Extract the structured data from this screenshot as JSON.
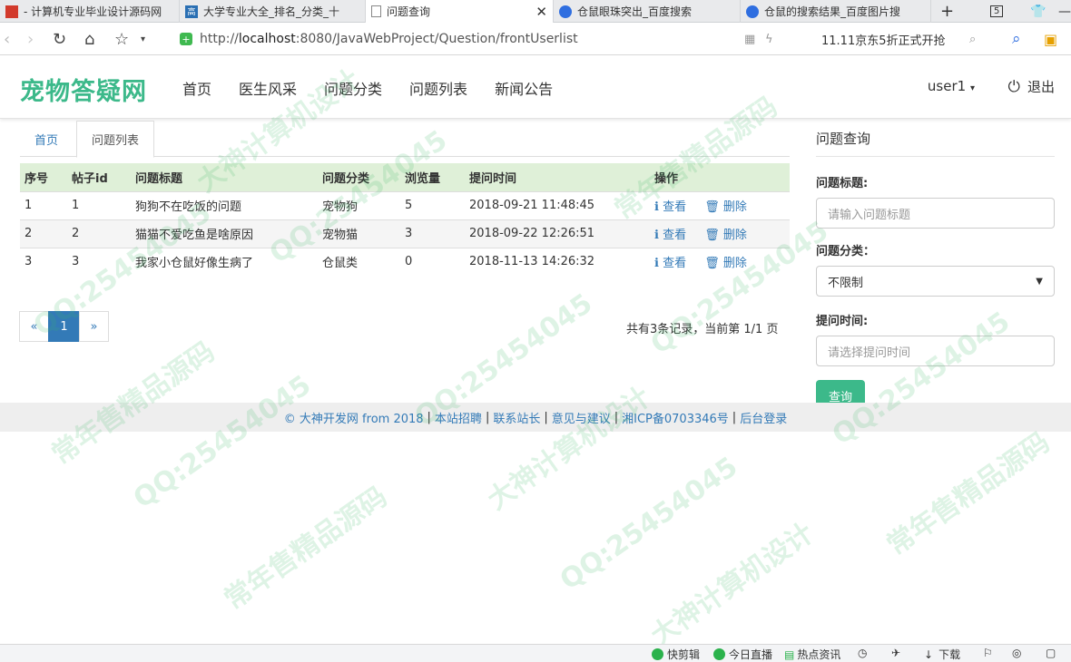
{
  "browser": {
    "tabs": [
      {
        "title": "- 计算机专业毕业设计源码网",
        "icon_color": "#d23a2c"
      },
      {
        "title": "大学专业大全_排名_分类_十",
        "icon_color": "#2a6fb3",
        "icon_text": "高"
      },
      {
        "title": "问题查询",
        "active": true
      },
      {
        "title": "仓鼠眼珠突出_百度搜索",
        "icon_color": "#2f6ee0"
      },
      {
        "title": "仓鼠的搜索结果_百度图片搜",
        "icon_color": "#2f6ee0"
      }
    ],
    "tab_count": "5",
    "url_prefix": "http://",
    "url_host": "localhost",
    "url_rest": ":8080/JavaWebProject/Question/frontUserlist",
    "search_text": "11.11京东5折正式开抢"
  },
  "header": {
    "logo": "宠物答疑网",
    "menu": [
      "首页",
      "医生风采",
      "问题分类",
      "问题列表",
      "新闻公告"
    ],
    "user": "user1",
    "logout": "退出"
  },
  "breadcrumb": {
    "home": "首页",
    "current": "问题列表"
  },
  "table": {
    "headers": [
      "序号",
      "帖子id",
      "问题标题",
      "问题分类",
      "浏览量",
      "提问时间",
      "操作"
    ],
    "rows": [
      [
        "1",
        "1",
        "狗狗不在吃饭的问题",
        "宠物狗",
        "5",
        "2018-09-21 11:48:45"
      ],
      [
        "2",
        "2",
        "猫猫不爱吃鱼是啥原因",
        "宠物猫",
        "3",
        "2018-09-22 12:26:51"
      ],
      [
        "3",
        "3",
        "我家小仓鼠好像生病了",
        "仓鼠类",
        "0",
        "2018-11-13 14:26:32"
      ]
    ],
    "view_label": "查看",
    "delete_label": "删除"
  },
  "pager": {
    "prev": "«",
    "current": "1",
    "next": "»",
    "info": "共有3条记录，当前第 1/1 页"
  },
  "sidebar": {
    "title": "问题查询",
    "title_label": "问题标题:",
    "title_placeholder": "请输入问题标题",
    "category_label": "问题分类：",
    "category_value": "不限制",
    "time_label": "提问时间:",
    "time_placeholder": "请选择提问时间",
    "submit": "查询"
  },
  "footer": {
    "links": [
      "© 大神开发网 from 2018",
      "本站招聘",
      "联系站长",
      "意见与建议",
      "湘ICP备0703346号",
      "后台登录"
    ]
  },
  "statusbar": [
    "快剪辑",
    "今日直播",
    "热点资讯",
    "下载"
  ],
  "watermarks": [
    "QQ:25454045",
    "大神计算机设计",
    "常年售精品源码"
  ],
  "colors": {
    "brand": "#3cb98a",
    "link": "#337ab7",
    "table_header": "#dff0d8"
  }
}
